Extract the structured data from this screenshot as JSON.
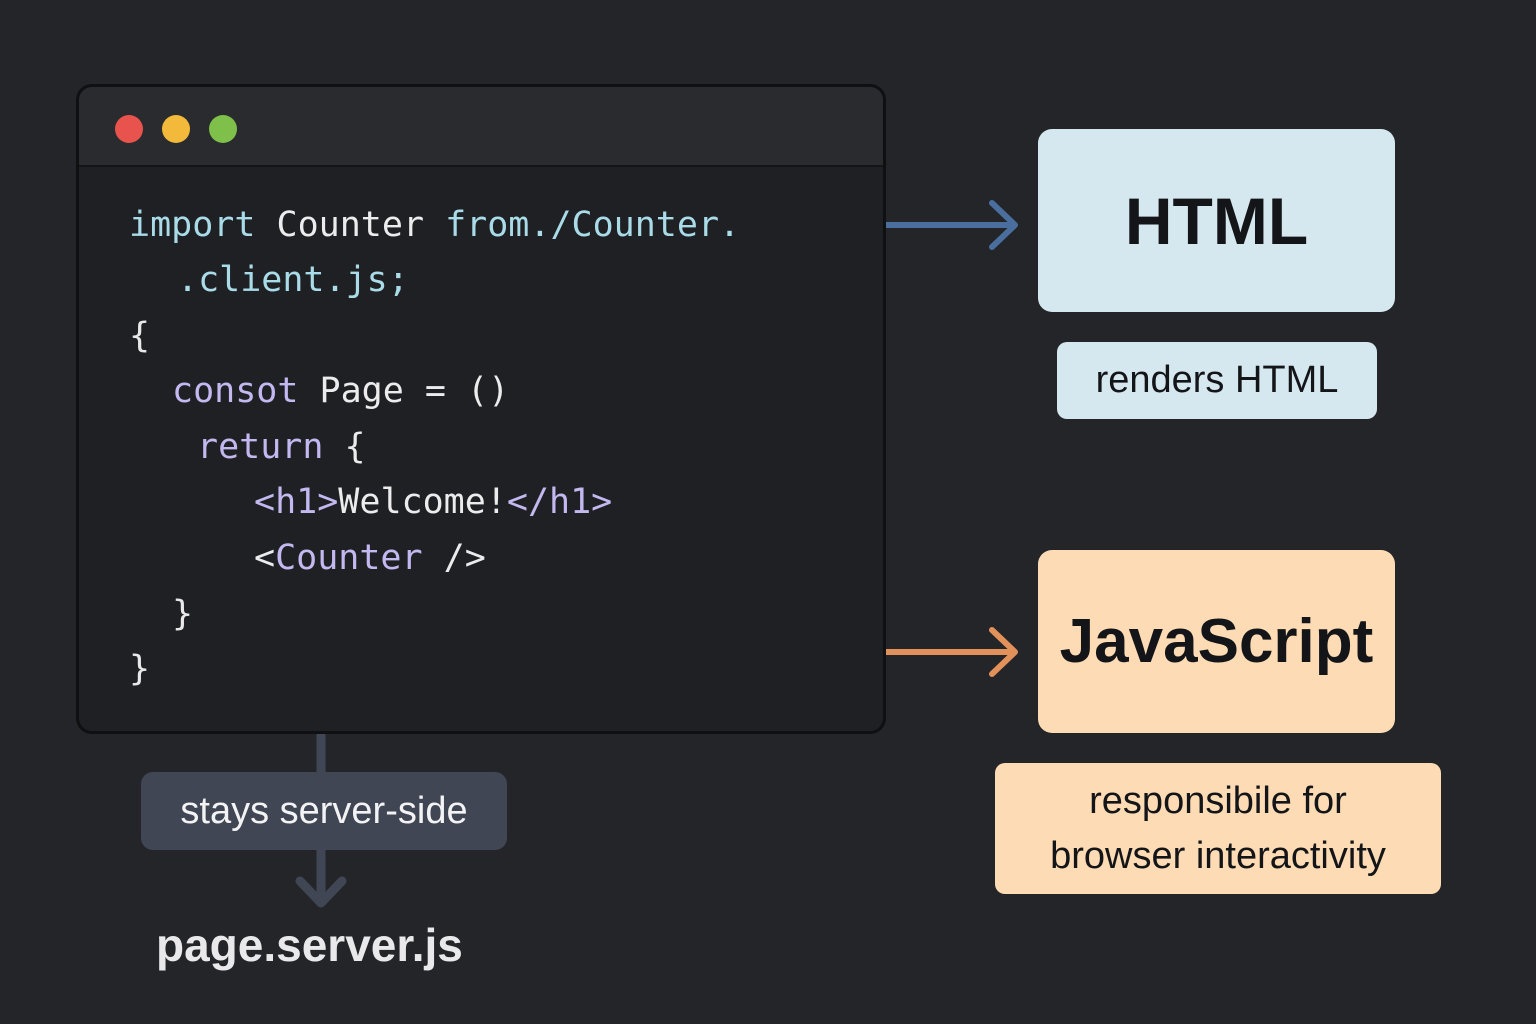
{
  "window": {
    "controls": [
      "close",
      "minimize",
      "maximize"
    ],
    "code_lines": {
      "l1_kw": "import",
      "l1_mid": " Counter ",
      "l1_from": "from./Counter.",
      "l2": ".client.js;",
      "l3": "{",
      "l4_kw": "consot",
      "l4_rest": " Page = ()",
      "l5_kw": "return",
      "l5_rest": " {",
      "l6_open": "<h1>",
      "l6_text": "Welcome!",
      "l6_close": "</h1>",
      "l7_open": "<",
      "l7_name": "Counter",
      "l7_close": " />",
      "l8": "}",
      "l9": "}"
    }
  },
  "outputs": {
    "html_title": "HTML",
    "html_label": "renders HTML",
    "js_title": "JavaScript",
    "js_label_line1": "responsibile for",
    "js_label_line2": "browser interactivity"
  },
  "server": {
    "label": "stays server-side",
    "filename": "page.server.js"
  },
  "colors": {
    "background": "#242528",
    "html_arrow": "#4a6f9e",
    "js_arrow": "#e3915a",
    "server_arrow": "#414654",
    "html_box": "#d6e8ef",
    "js_box": "#fddbb4"
  }
}
